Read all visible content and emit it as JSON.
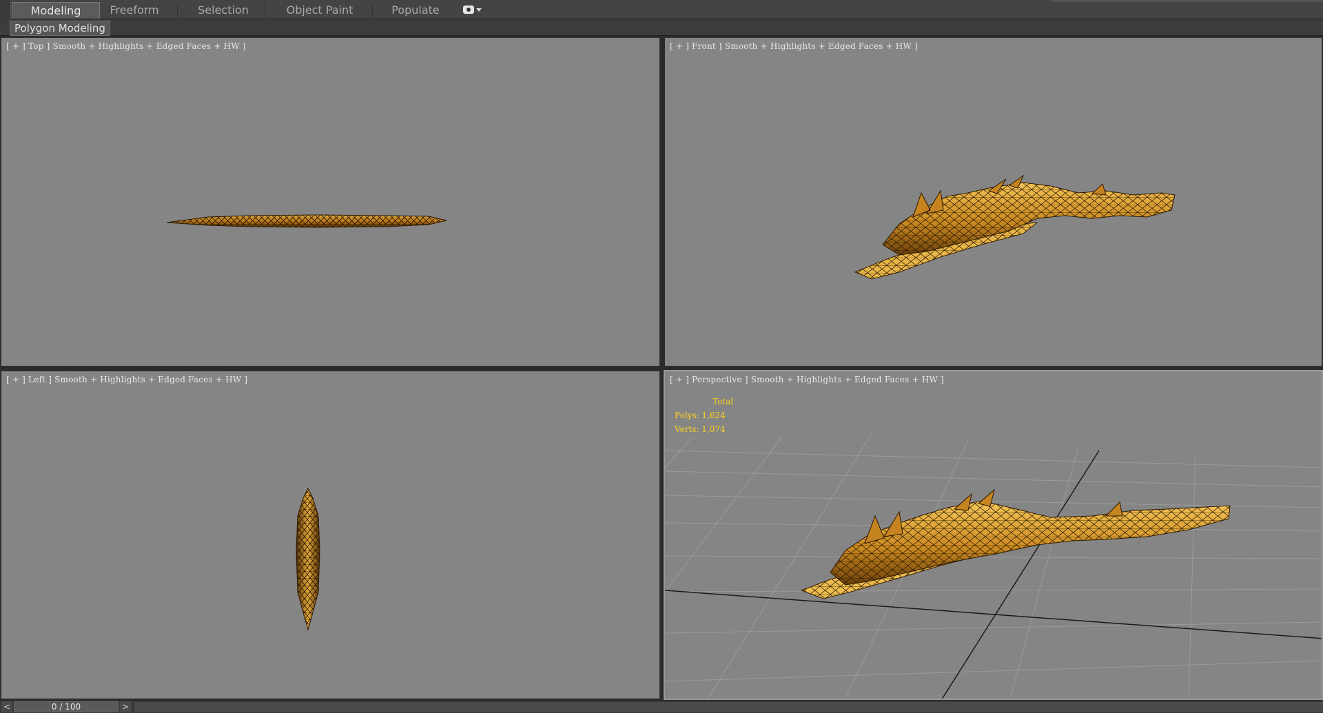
{
  "ribbon": {
    "tabs": [
      {
        "label": "Modeling",
        "active": true
      },
      {
        "label": "Freeform",
        "active": false
      },
      {
        "label": "Selection",
        "active": false
      },
      {
        "label": "Object Paint",
        "active": false
      },
      {
        "label": "Populate",
        "active": false
      }
    ],
    "extra_icon": "eye-icon",
    "extra_dropdown_icon": "chevron-down-icon"
  },
  "panel": {
    "active_panel": "Polygon Modeling"
  },
  "viewports": {
    "top": {
      "label": "[ + ] Top ] Smooth + Highlights + Edged Faces + HW ]"
    },
    "front": {
      "label": "[ + ] Front ] Smooth + Highlights + Edged Faces + HW ]"
    },
    "left": {
      "label": "[ + ] Left ] Smooth + Highlights + Edged Faces + HW ]"
    },
    "perspective": {
      "label": "[ + ] Perspective ] Smooth + Highlights + Edged Faces + HW ]",
      "stats": {
        "header": "Total",
        "polys": "Polys: 1,624",
        "verts": "Verts: 1,074"
      }
    }
  },
  "timeline": {
    "prev_label": "<",
    "next_label": ">",
    "frame": "0 / 100"
  },
  "colors": {
    "viewport_bg": "#858585",
    "model_gold": "#d69a25",
    "stats_yellow": "#ffd21a"
  }
}
